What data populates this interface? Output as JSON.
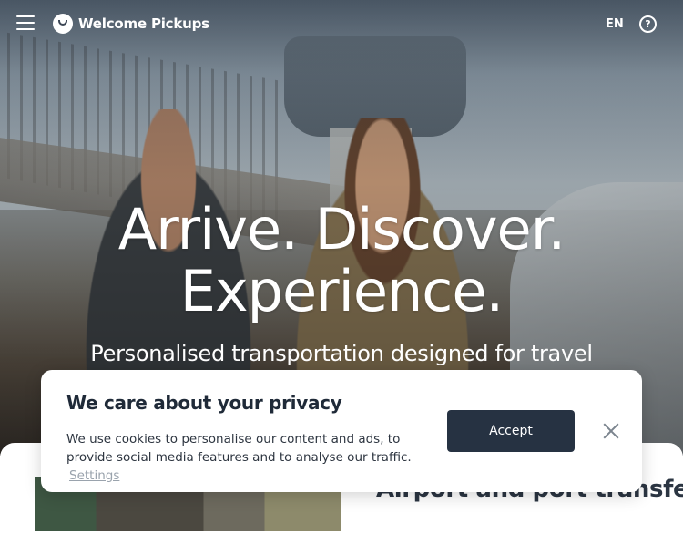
{
  "nav": {
    "menu_icon": "hamburger-icon",
    "logo_icon": "welcome-pickups-logo-icon",
    "brand_name": "Welcome Pickups",
    "language": "EN",
    "help_icon": "question-circle-icon",
    "help_glyph": "?"
  },
  "hero": {
    "headline_line1": "Arrive. Discover.",
    "headline_line2": "Experience.",
    "subheadline": "Personalised transportation designed for travel"
  },
  "content": {
    "section_title": "Airport and port transfers"
  },
  "privacy": {
    "title": "We care about your privacy",
    "text": "We use cookies to personalise our content and ads, to provide social media features and to analyse our traffic.",
    "settings_link": "Settings",
    "accept_label": "Accept",
    "close_icon": "close-icon"
  },
  "colors": {
    "accept_button_bg": "#263242",
    "title_text": "#1f2a38",
    "link_gray": "#9aa3ad"
  }
}
